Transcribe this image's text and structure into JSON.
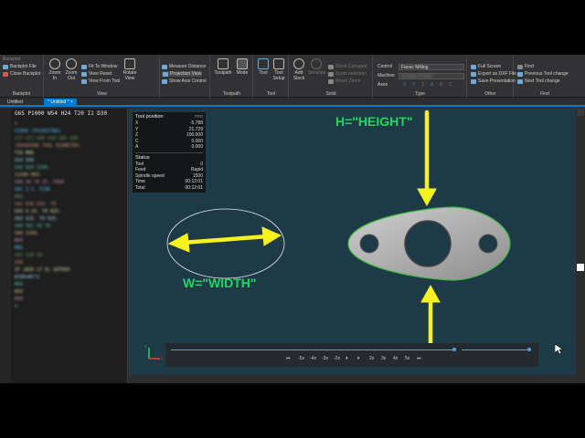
{
  "ribbon": {
    "backplot": {
      "label": "Backplot",
      "items": [
        "Backplot File",
        "Close Backplot"
      ]
    },
    "view": {
      "label": "View",
      "zoom_in": "Zoom In",
      "zoom_out": "Zoom Out",
      "fit": "Fit To Window",
      "reset": "View Reset",
      "from_tool": "View From Tool",
      "rotate": "Rotate View",
      "measure": "Measure Distance",
      "projection": "Projection View",
      "axis": "Show Axis Control"
    },
    "toolpath": {
      "label": "Toolpath",
      "toolpath": "Toolpath",
      "mode": "Mode"
    },
    "tool": {
      "label": "Tool",
      "tool": "Tool",
      "setup": "Tool Setup"
    },
    "solid": {
      "label": "Solid",
      "add_stock": "Add Stock",
      "simulate": "Simulate",
      "stock_compare": "Stock Compare",
      "zoom_selection": "Zoom selection",
      "reset_zoom": "Reset Zoom"
    },
    "type": {
      "label": "Type",
      "control_label": "Control",
      "control_value": "Fanuc Milling",
      "machine_label": "Machine",
      "machine_value": "Doosan VC630",
      "axes_label": "Axes",
      "axes": [
        "X",
        "Y",
        "Z",
        "A",
        "B",
        "C"
      ]
    },
    "other": {
      "label": "Other",
      "full_screen": "Full Screen",
      "export_dxf": "Export as DXF File",
      "save_presentation": "Save Presentation"
    },
    "find": {
      "label": "Find",
      "find": "Find",
      "prev": "Previous Tool change",
      "next": "Next Tool change"
    }
  },
  "tabs": [
    "Untitled",
    "* Untitled *"
  ],
  "editor": {
    "first_line": "G65 P1000 W54 H24 T20 I1 D30",
    "lines": [
      "%",
      "O1000 (POCKETING)",
      "G17 G21 G40 G49 G80 G90",
      "(ROUGHING TOOL DIAMETER)",
      "T20 M06",
      "G54 G90",
      "G43 H20 Z100.",
      "S1500 M03",
      "G00 X0 Y0 Z5. F800",
      "G01 Z-5. F200",
      "M08",
      "G41 D30 X25. Y0",
      "G03 X-25. Y0 R25.",
      "G03 X25. Y0 R25.",
      "G40 G01 X0 Y0",
      "G00 Z100.",
      "M09",
      "M05",
      "G91 G28 Z0.",
      "G90",
      "IF [#20 LT 0] GOTO99",
      "#100=#1*2",
      "M99",
      "N99",
      "M30",
      "%"
    ]
  },
  "tool_position": {
    "title": "Tool position",
    "unit": "mm",
    "rows": [
      {
        "k": "X",
        "v": "-5.788"
      },
      {
        "k": "Y",
        "v": "21.729"
      },
      {
        "k": "Z",
        "v": "100.000"
      },
      {
        "k": "C",
        "v": "0.000"
      },
      {
        "k": "A",
        "v": "0.000"
      }
    ],
    "status_title": "Status",
    "status": [
      {
        "k": "Tool",
        "v": "0"
      },
      {
        "k": "Feed",
        "v": "Rapid"
      },
      {
        "k": "Spindle speed",
        "v": "1500"
      },
      {
        "k": "Time",
        "v": "00:12:01"
      },
      {
        "k": "Total",
        "v": "00:12:01"
      }
    ]
  },
  "annotations": {
    "height": "H=\"HEIGHT\"",
    "width": "W=\"WIDTH\""
  },
  "axis_labels": {
    "x": "X",
    "y": "Y"
  },
  "playback": {
    "controls": [
      "⏮",
      "-5x",
      "-4x",
      "-3x",
      "-2x",
      "⏴",
      "⏵",
      "2x",
      "3x",
      "4x",
      "5x",
      "⏭"
    ]
  },
  "colors": {
    "annotation_green": "#1ed760",
    "arrow_yellow": "#f7f21f",
    "viewport_bg": "#1f3a47",
    "accent_blue": "#007acc"
  }
}
